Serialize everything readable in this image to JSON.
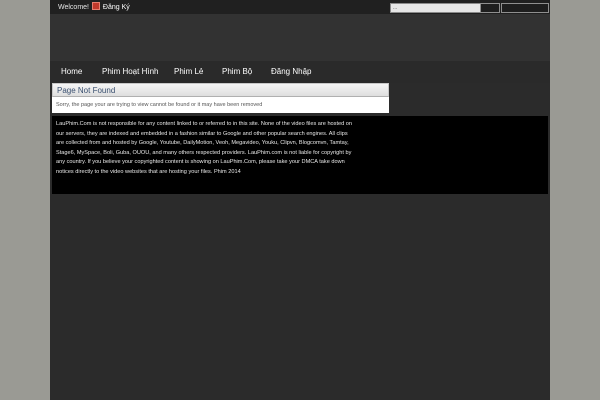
{
  "topbar": {
    "welcome": "Welcome!",
    "register_link": "Đăng Ký",
    "search_placeholder": "..."
  },
  "nav": {
    "items": [
      "Home",
      "Phim Hoạt Hình",
      "Phim Lẻ",
      "Phim Bộ",
      "Đăng Nhập"
    ]
  },
  "notice": {
    "title": "Page Not Found",
    "message": "Sorry, the page your are trying to view cannot be found or it may have been removed"
  },
  "footer": {
    "disclaimer": "LauPhim.Com is not responsible for any content linked to or referred to in this site. None of the video files are hosted on our servers, they are indexed and embedded in a fashion similar to Google and other popular search engines. All clips are collected from and hosted by Google, Youtube, DailyMotion, Veoh, Megavideo, Youku, Clipvn, Blogcomvn, Tamtay, Stage6, MySpace, Boli, Guba, OUOU, and many others respected providers. LauPhim.com is not liable for copyright by any country. If you believe your copyrighted content is showing on LauPhim.Com, please take your DMCA take down notices directly to the video websites that are hosting your files. Phim 2014"
  }
}
